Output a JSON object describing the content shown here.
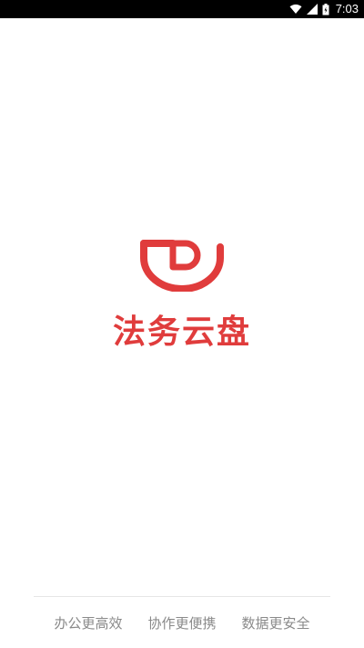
{
  "status_bar": {
    "time": "7:03",
    "icons": [
      "wifi-icon",
      "cellular-signal-icon",
      "battery-icon"
    ]
  },
  "splash": {
    "logo_icon": "fawu-yunpan-logo-icon",
    "app_name": "法务云盘",
    "brand_color": "#e03c3c"
  },
  "footer": {
    "slogans": [
      "办公更高效",
      "协作更便携",
      "数据更安全"
    ]
  }
}
